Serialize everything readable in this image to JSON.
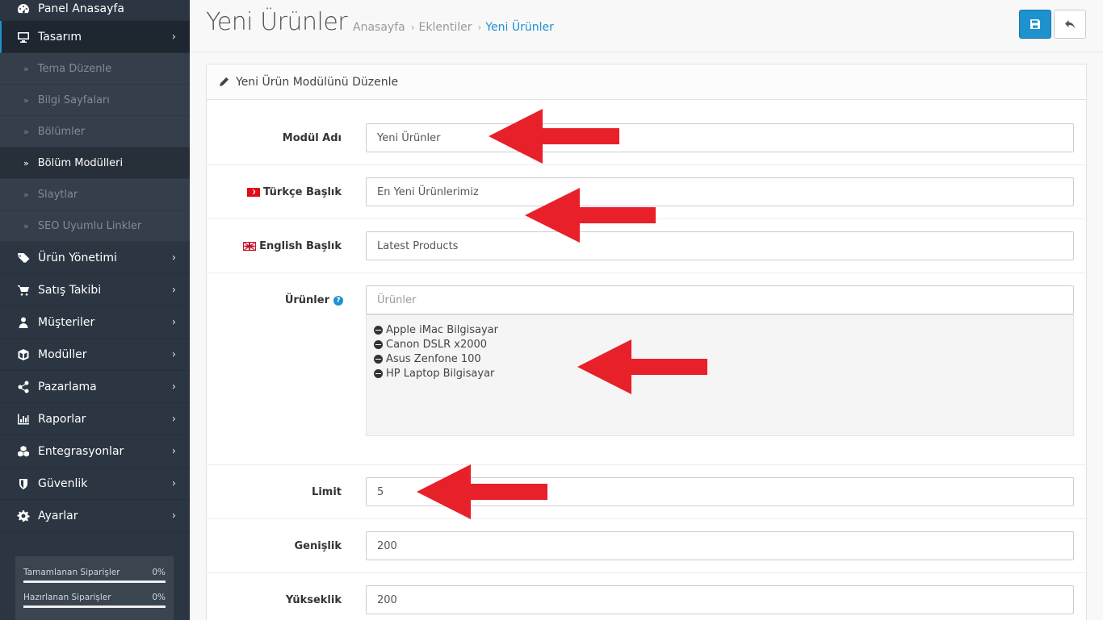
{
  "sidebar": {
    "items": [
      {
        "label": "Panel Anasayfa",
        "icon": "dashboard-icon"
      },
      {
        "label": "Tasarım",
        "icon": "monitor-icon"
      },
      {
        "label": "Ürün Yönetimi",
        "icon": "tags-icon"
      },
      {
        "label": "Satış Takibi",
        "icon": "cart-icon"
      },
      {
        "label": "Müşteriler",
        "icon": "user-icon"
      },
      {
        "label": "Modüller",
        "icon": "cube-icon"
      },
      {
        "label": "Pazarlama",
        "icon": "share-icon"
      },
      {
        "label": "Raporlar",
        "icon": "bar-chart-icon"
      },
      {
        "label": "Entegrasyonlar",
        "icon": "cubes-icon"
      },
      {
        "label": "Güvenlik",
        "icon": "shield-icon"
      },
      {
        "label": "Ayarlar",
        "icon": "gear-icon"
      }
    ],
    "submenu": [
      {
        "label": "Tema Düzenle"
      },
      {
        "label": "Bilgi Sayfaları"
      },
      {
        "label": "Bölümler"
      },
      {
        "label": "Bölüm Modülleri"
      },
      {
        "label": "Slaytlar"
      },
      {
        "label": "SEO Uyumlu Linkler"
      }
    ],
    "stats": [
      {
        "label": "Tamamlanan Siparişler",
        "value": "0%",
        "progress": 0
      },
      {
        "label": "Hazırlanan Siparişler",
        "value": "0%",
        "progress": 0
      }
    ]
  },
  "header": {
    "title": "Yeni Ürünler",
    "breadcrumb": [
      "Anasayfa",
      "Eklentiler",
      "Yeni Ürünler"
    ],
    "accent": "#1e91cf"
  },
  "panel": {
    "heading": "Yeni Ürün Modülünü Düzenle",
    "fields": {
      "module_name": {
        "label": "Modül Adı",
        "value": "Yeni Ürünler"
      },
      "title_tr": {
        "label": "Türkçe Başlık",
        "value": "En Yeni Ürünlerimiz"
      },
      "title_en": {
        "label": "English Başlık",
        "value": "Latest Products"
      },
      "products": {
        "label": "Ürünler",
        "placeholder": "Ürünler"
      },
      "limit": {
        "label": "Limit",
        "value": "5"
      },
      "width": {
        "label": "Genişlik",
        "value": "200"
      },
      "height": {
        "label": "Yükseklik",
        "value": "200"
      }
    },
    "product_list": [
      "Apple iMac Bilgisayar",
      "Canon DSLR x2000",
      "Asus Zenfone 100",
      "HP Laptop Bilgisayar"
    ]
  },
  "annotation_color": "#e8202a"
}
